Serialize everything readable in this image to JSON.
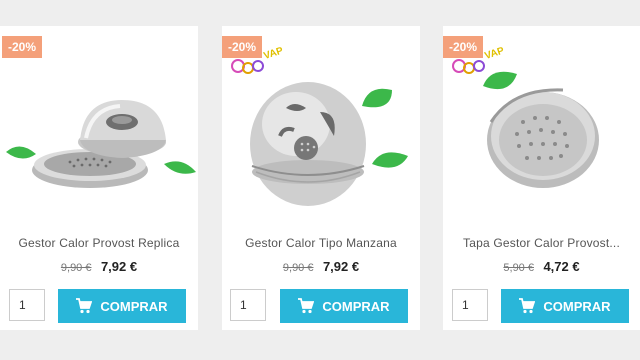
{
  "products": [
    {
      "discount": "-20%",
      "title": "Gestor Calor Provost Replica",
      "old_price": "9,90 €",
      "new_price": "7,92 €",
      "quantity": "1",
      "button_label": "COMPRAR",
      "image": "heat-manager-open-lid"
    },
    {
      "discount": "-20%",
      "title": "Gestor Calor Tipo Manzana",
      "old_price": "9,90 €",
      "new_price": "7,92 €",
      "quantity": "1",
      "button_label": "COMPRAR",
      "image": "heat-manager-apple"
    },
    {
      "discount": "-20%",
      "title": "Tapa Gestor Calor Provost...",
      "old_price": "5,90 €",
      "new_price": "4,72 €",
      "quantity": "1",
      "button_label": "COMPRAR",
      "image": "heat-manager-lid-tray"
    }
  ],
  "colors": {
    "accent": "#29b6d9",
    "badge": "#f4a07a",
    "leaf": "#3cb84a"
  },
  "icons": {
    "cart": "shopping-cart-icon",
    "logo": "vap-logo"
  }
}
